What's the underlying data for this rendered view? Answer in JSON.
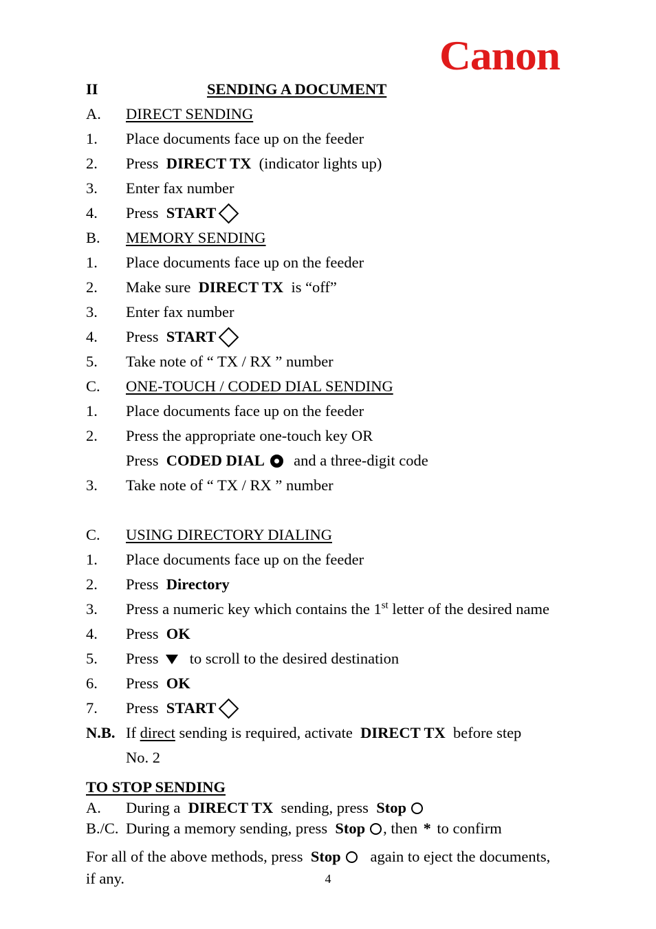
{
  "document": {
    "brand": {
      "name": "Canon",
      "color": "#e01b1b"
    },
    "section_number": "II",
    "section_title": "SENDING A DOCUMENT",
    "page_number": "4"
  },
  "parts": {
    "a": {
      "marker": "A.",
      "heading": "DIRECT SENDING",
      "steps": [
        {
          "marker": "1.",
          "text": "Place documents face up on the feeder"
        },
        {
          "marker": "2.",
          "pre": "Press",
          "bold": "DIRECT TX",
          "post": "(indicator lights up)"
        },
        {
          "marker": "3.",
          "text": "Enter fax number"
        },
        {
          "marker": "4.",
          "pre": "Press",
          "bold": "START",
          "icon": "diamond-icon",
          "post": ""
        }
      ]
    },
    "b": {
      "marker": "B.",
      "heading": "MEMORY SENDING",
      "steps": [
        {
          "marker": "1.",
          "text": "Place documents face up on the feeder"
        },
        {
          "marker": "2.",
          "pre": "Make sure",
          "bold": "DIRECT TX",
          "post": "is  “off”"
        },
        {
          "marker": "3.",
          "text": "Enter fax number"
        },
        {
          "marker": "4.",
          "pre": "Press",
          "bold": "START",
          "icon": "diamond-icon",
          "post": ""
        },
        {
          "marker": "5.",
          "text": "Take note of  “ TX / RX ”  number"
        }
      ]
    },
    "c1": {
      "marker": "C.",
      "heading": "ONE-TOUCH / CODED DIAL SENDING",
      "steps": [
        {
          "marker": "1.",
          "text": "Place documents face up on the feeder"
        },
        {
          "marker": "2.",
          "text": "Press the appropriate one-touch key  OR"
        },
        {
          "marker": "",
          "pre": "Press",
          "bold": "CODED DIAL",
          "icon": "ring-icon",
          "post": "and a three-digit code"
        },
        {
          "marker": "3.",
          "text": "Take note of  “ TX / RX ”  number"
        }
      ]
    },
    "c2": {
      "marker": "C.",
      "heading": "USING DIRECTORY DIALING",
      "steps": [
        {
          "marker": "1.",
          "text": "Place documents face up on the feeder"
        },
        {
          "marker": "2.",
          "pre": "Press",
          "bold": "Directory",
          "post": ""
        },
        {
          "marker": "3.",
          "pre_sup": "Press a numeric key which contains the 1",
          "sup": "st",
          "post_sup": " letter of the desired name"
        },
        {
          "marker": "4.",
          "pre": "Press",
          "bold": "OK",
          "post": ""
        },
        {
          "marker": "5.",
          "pre": "Press",
          "icon": "triangle-down-icon",
          "post": "to scroll to the desired destination"
        },
        {
          "marker": "6.",
          "pre": "Press",
          "bold": "OK",
          "post": ""
        },
        {
          "marker": "7.",
          "pre": "Press",
          "bold": "START",
          "icon": "diamond-icon",
          "post": ""
        }
      ]
    }
  },
  "note": {
    "marker": "N.B.",
    "pre": "If",
    "underlined": "direct",
    "mid": "sending is required, activate",
    "bold": "DIRECT TX",
    "post": "before step",
    "line2": "No. 2"
  },
  "stop": {
    "heading": "TO STOP SENDING",
    "lines": [
      {
        "marker": "A.",
        "pre": "During a",
        "bold1": "DIRECT TX",
        "mid": "sending, press",
        "bold2": "Stop",
        "icon": "circle-icon",
        "post": ""
      },
      {
        "marker": "B./C.",
        "pre": "During a memory sending, press",
        "bold2": "Stop",
        "icon": "circle-icon",
        "post_comma": ",  then",
        "asterisk": "*",
        "post": "to confirm"
      }
    ],
    "final": {
      "pre": "For all of the above methods, press",
      "bold": "Stop",
      "icon": "circle-icon",
      "post": "again to eject the documents,",
      "line2": "if any."
    }
  }
}
